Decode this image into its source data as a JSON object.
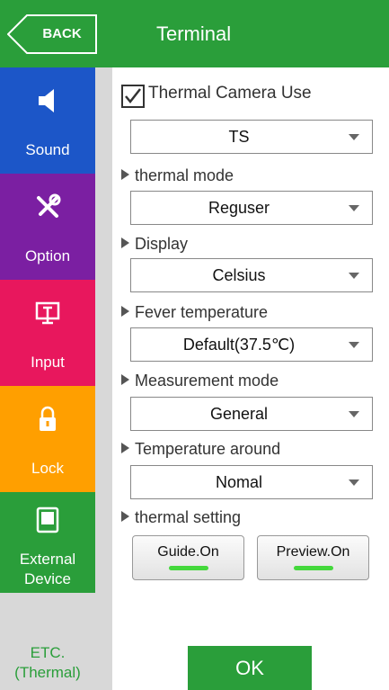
{
  "header": {
    "back_label": "BACK",
    "title": "Terminal"
  },
  "sidebar": {
    "items": [
      {
        "label": "Sound",
        "color": "#1c56c8",
        "icon": "speaker-icon"
      },
      {
        "label": "Option",
        "color": "#7b1fa2",
        "icon": "tools-icon"
      },
      {
        "label": "Input",
        "color": "#e8175d",
        "icon": "monitor-icon"
      },
      {
        "label": "Lock",
        "color": "#ff9f00",
        "icon": "lock-icon"
      },
      {
        "label": "External Device",
        "color": "#2a9e3a",
        "icon": "device-icon"
      }
    ],
    "etc_label": "ETC.\n(Thermal)"
  },
  "content": {
    "thermal_camera_use": {
      "label": "Thermal Camera Use",
      "checked": true
    },
    "camera_select": "TS",
    "sections": {
      "thermal_mode": {
        "label": "thermal mode",
        "value": "Reguser"
      },
      "display": {
        "label": "Display",
        "value": "Celsius"
      },
      "fever_temperature": {
        "label": "Fever temperature",
        "value": "Default(37.5℃)"
      },
      "measurement_mode": {
        "label": "Measurement mode",
        "value": "General"
      },
      "temperature_around": {
        "label": "Temperature around",
        "value": "Nomal"
      },
      "thermal_setting": {
        "label": "thermal setting"
      }
    },
    "guide_button": "Guide.On",
    "preview_button": "Preview.On",
    "ok_button": "OK"
  },
  "colors": {
    "header_green": "#2a9e3a",
    "indicator_green": "#44d83c"
  }
}
